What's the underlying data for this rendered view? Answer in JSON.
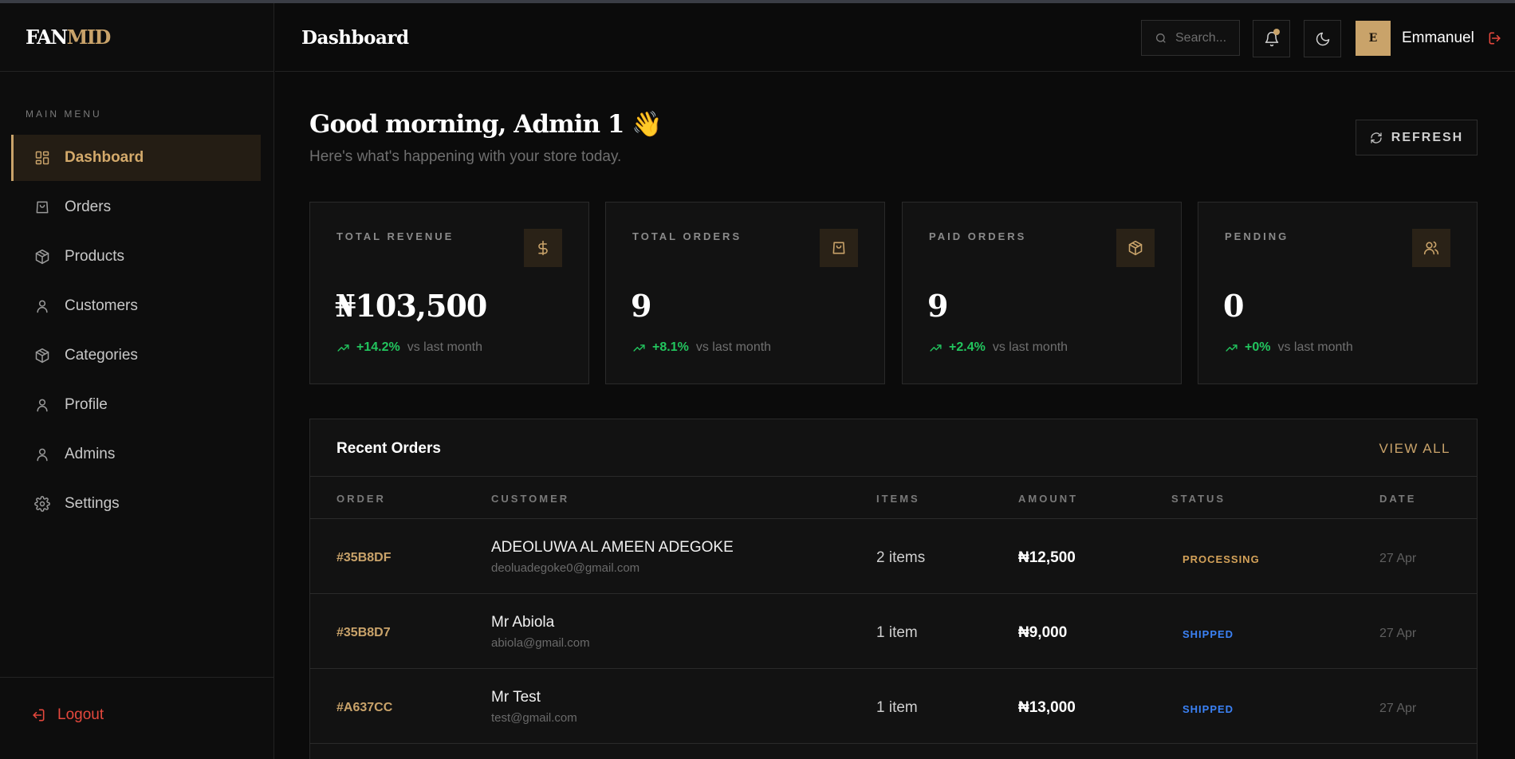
{
  "app": {
    "logo_part1": "FAN",
    "logo_part2": "MID",
    "colors": {
      "accent": "#c9a36a",
      "danger": "#e5483d",
      "success": "#22c55e",
      "shipped": "#3b82f6",
      "background": "#0b0b0b"
    }
  },
  "sidebar": {
    "menu_label": "MAIN MENU",
    "items": [
      {
        "label": "Dashboard",
        "icon": "dashboard-icon",
        "active": true
      },
      {
        "label": "Orders",
        "icon": "shopping-bag-icon",
        "active": false
      },
      {
        "label": "Products",
        "icon": "box-icon",
        "active": false
      },
      {
        "label": "Customers",
        "icon": "user-icon",
        "active": false
      },
      {
        "label": "Categories",
        "icon": "box-icon",
        "active": false
      },
      {
        "label": "Profile",
        "icon": "user-icon",
        "active": false
      },
      {
        "label": "Admins",
        "icon": "user-icon",
        "active": false
      },
      {
        "label": "Settings",
        "icon": "gear-icon",
        "active": false
      }
    ],
    "logout_label": "Logout"
  },
  "header": {
    "title": "Dashboard",
    "search_placeholder": "Search...",
    "avatar_initial": "E",
    "username": "Emmanuel"
  },
  "main": {
    "greeting": "Good morning, Admin 1 👋",
    "subtitle": "Here's what's happening with your store today.",
    "refresh_label": "REFRESH",
    "stats": [
      {
        "label": "TOTAL REVENUE",
        "icon": "dollar-icon",
        "value": "₦103,500",
        "change": "+14.2%",
        "change_note": "vs last month"
      },
      {
        "label": "TOTAL ORDERS",
        "icon": "shopping-bag-icon",
        "value": "9",
        "change": "+8.1%",
        "change_note": "vs last month"
      },
      {
        "label": "PAID ORDERS",
        "icon": "box-icon",
        "value": "9",
        "change": "+2.4%",
        "change_note": "vs last month"
      },
      {
        "label": "PENDING",
        "icon": "users-icon",
        "value": "0",
        "change": "+0%",
        "change_note": "vs last month"
      }
    ],
    "recent_orders": {
      "title": "Recent Orders",
      "view_all_label": "VIEW ALL",
      "columns": [
        "ORDER",
        "CUSTOMER",
        "ITEMS",
        "AMOUNT",
        "STATUS",
        "DATE"
      ],
      "rows": [
        {
          "order": "#35B8DF",
          "customer_name": "ADEOLUWA AL AMEEN ADEGOKE",
          "customer_email": "deoluadegoke0@gmail.com",
          "items": "2 items",
          "amount": "₦12,500",
          "status": "PROCESSING",
          "status_color": "#d4a259",
          "date": "27 Apr"
        },
        {
          "order": "#35B8D7",
          "customer_name": "Mr Abiola",
          "customer_email": "abiola@gmail.com",
          "items": "1 item",
          "amount": "₦9,000",
          "status": "SHIPPED",
          "status_color": "#3b82f6",
          "date": "27 Apr"
        },
        {
          "order": "#A637CC",
          "customer_name": "Mr Test",
          "customer_email": "test@gmail.com",
          "items": "1 item",
          "amount": "₦13,000",
          "status": "SHIPPED",
          "status_color": "#3b82f6",
          "date": "27 Apr"
        }
      ]
    }
  }
}
